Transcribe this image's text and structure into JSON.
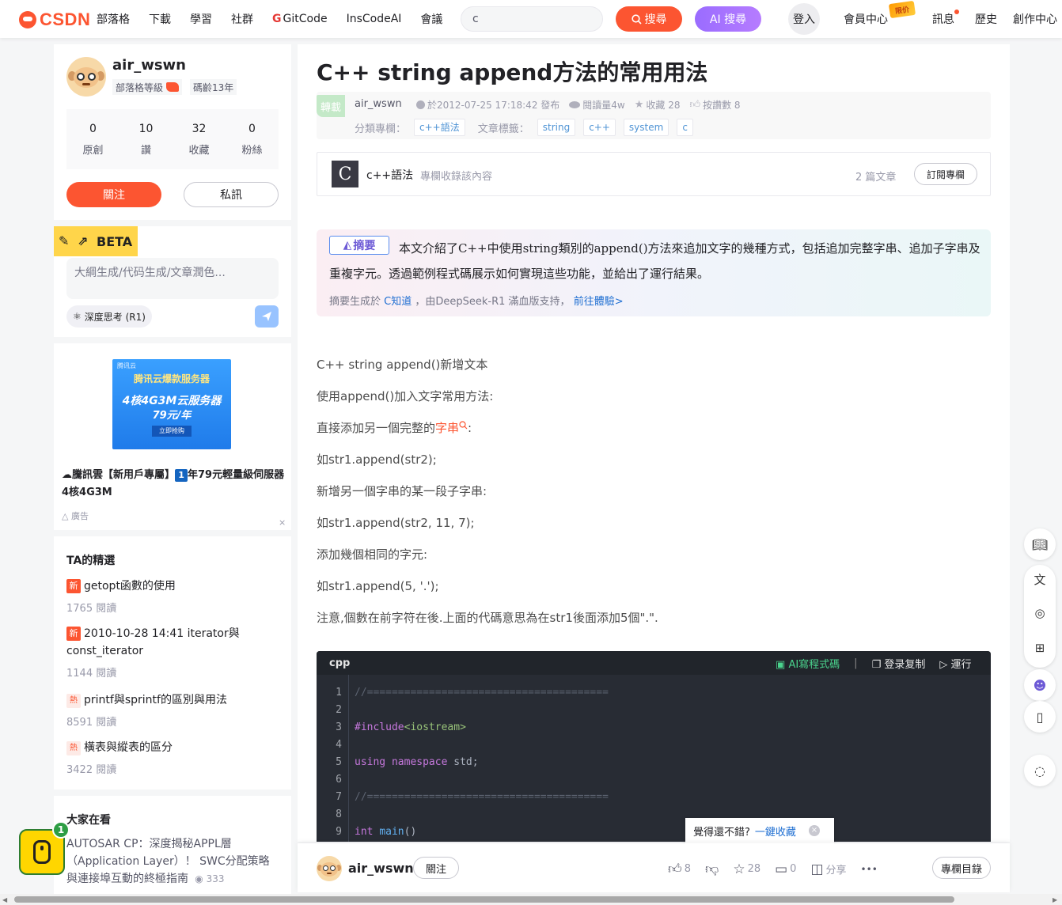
{
  "header": {
    "logo_text": "CSDN",
    "nav": [
      "部落格",
      "下載",
      "學習",
      "社群",
      "GitCode",
      "InsCodeAI",
      "會議"
    ],
    "search_value": "c",
    "search_label": "搜尋",
    "ai_search_label": "AI 搜尋",
    "login_label": "登入",
    "vip_label": "會員中心",
    "vip_badge": "限价",
    "messages_label": "訊息",
    "history_label": "歷史",
    "creator_label": "創作中心"
  },
  "profile": {
    "username": "air_wswn",
    "level_label": "部落格等級",
    "age_label": "碼齡13年",
    "stats": [
      {
        "num": "0",
        "label": "原創"
      },
      {
        "num": "10",
        "label": "讚"
      },
      {
        "num": "32",
        "label": "收藏"
      },
      {
        "num": "0",
        "label": "粉絲"
      }
    ],
    "follow_label": "關注",
    "pm_label": "私訊"
  },
  "ai_assistant": {
    "beta_label": "BETA",
    "placeholder": "大綱生成/代码生成/文章潤色...",
    "deep_think_label": "深度思考 (R1)"
  },
  "ad": {
    "img_small": "腾讯云",
    "img_line1": "腾讯云爆款服务器",
    "img_line2": "4核4G3M云服务器",
    "img_line3": "79元/年",
    "img_btn": "立即抢购",
    "title_prefix": "☁騰訊雲【新用戶專屬】",
    "title_badge": "1",
    "title_suffix": "年79元輕量級伺服器4核4G3M",
    "mark": "廣告",
    "close": "×"
  },
  "picks": {
    "title": "TA的精選",
    "items": [
      {
        "tag": "新",
        "tag_type": "new",
        "title": "getopt函數的使用",
        "views": "1765 閱讀"
      },
      {
        "tag": "新",
        "tag_type": "new",
        "title": "2010-10-28 14:41 iterator與const_iterator",
        "views": "1144 閱讀"
      },
      {
        "tag": "熱",
        "tag_type": "hot",
        "title": "printf與sprintf的區別與用法",
        "views": "8591 閱讀"
      },
      {
        "tag": "熱",
        "tag_type": "hot",
        "title": "橫表與縱表的區分",
        "views": "3422 閱讀"
      }
    ]
  },
  "trending": {
    "title": "大家在看",
    "text": "AUTOSAR CP：深度揭秘APPL層（Application Layer）！ SWC分配策略與連接埠互動的終極指南",
    "views": "333"
  },
  "floating_widget": {
    "count": "1"
  },
  "article": {
    "title": "C++ string append方法的常用用法",
    "repost_label": "轉載",
    "author": "air_wswn",
    "date": "於2012-07-25 17:18:42 發布",
    "reads": "閱讀量4w",
    "favorites": "收藏 28",
    "likes": "按讚數 8",
    "column_label": "分類專欄：",
    "column_tag": "c++語法",
    "tags_label": "文章標籤：",
    "tags": [
      "string",
      "c++",
      "system",
      "c"
    ],
    "column": {
      "img_letter": "C",
      "name": "c++語法",
      "desc": "專欄收錄該內容",
      "count": "2 篇文章",
      "subscribe": "訂閱專欄"
    },
    "summary": {
      "badge": "摘要",
      "text": "本文介紹了C++中使用string類別的append()方法來追加文字的幾種方式，包括追加完整字串、追加子字串及重複字元。透過範例程式碼展示如何實現這些功能，並給出了運行結果。",
      "foot_prefix": "摘要生成於",
      "foot_link1": "C知道",
      "foot_mid": "，由DeepSeek-R1 滿血版支持，",
      "foot_link2": "前往體驗>"
    },
    "body": [
      "C++ string append()新增文本",
      "使用append()加入文字常用方法:",
      "直接添加另一個完整的",
      "如str1.append(str2);",
      "新增另一個字串的某一段子字串:",
      "如str1.append(str2, 11, 7);",
      "添加幾個相同的字元:",
      "如str1.append(5, '.');",
      "注意,個數在前字符在後.上面的代碼意思為在str1後面添加5個\".\"."
    ],
    "body_keyword": "字串",
    "body_keyword_suffix": ":",
    "code": {
      "lang": "cpp",
      "ai_label": "AI寫程式碼",
      "copy_label": "登录复制",
      "run_label": "運行",
      "lines": [
        {
          "n": "1",
          "text": "//======================================="
        },
        {
          "n": "2",
          "text": ""
        },
        {
          "n": "3",
          "text": "#include<iostream>"
        },
        {
          "n": "4",
          "text": ""
        },
        {
          "n": "5",
          "text": "using namespace std;"
        },
        {
          "n": "6",
          "text": ""
        },
        {
          "n": "7",
          "text": "//======================================="
        },
        {
          "n": "8",
          "text": ""
        },
        {
          "n": "9",
          "text": "int main()"
        }
      ]
    }
  },
  "tooltip": {
    "text": "覺得還不錯?",
    "link": "一鍵收藏",
    "close": "×"
  },
  "bottom_bar": {
    "author": "air_wswn",
    "follow_label": "關注",
    "likes": "8",
    "favorites": "28",
    "comments": "0",
    "share_label": "分享",
    "more_label": "•••",
    "toc_label": "專欄目錄"
  }
}
